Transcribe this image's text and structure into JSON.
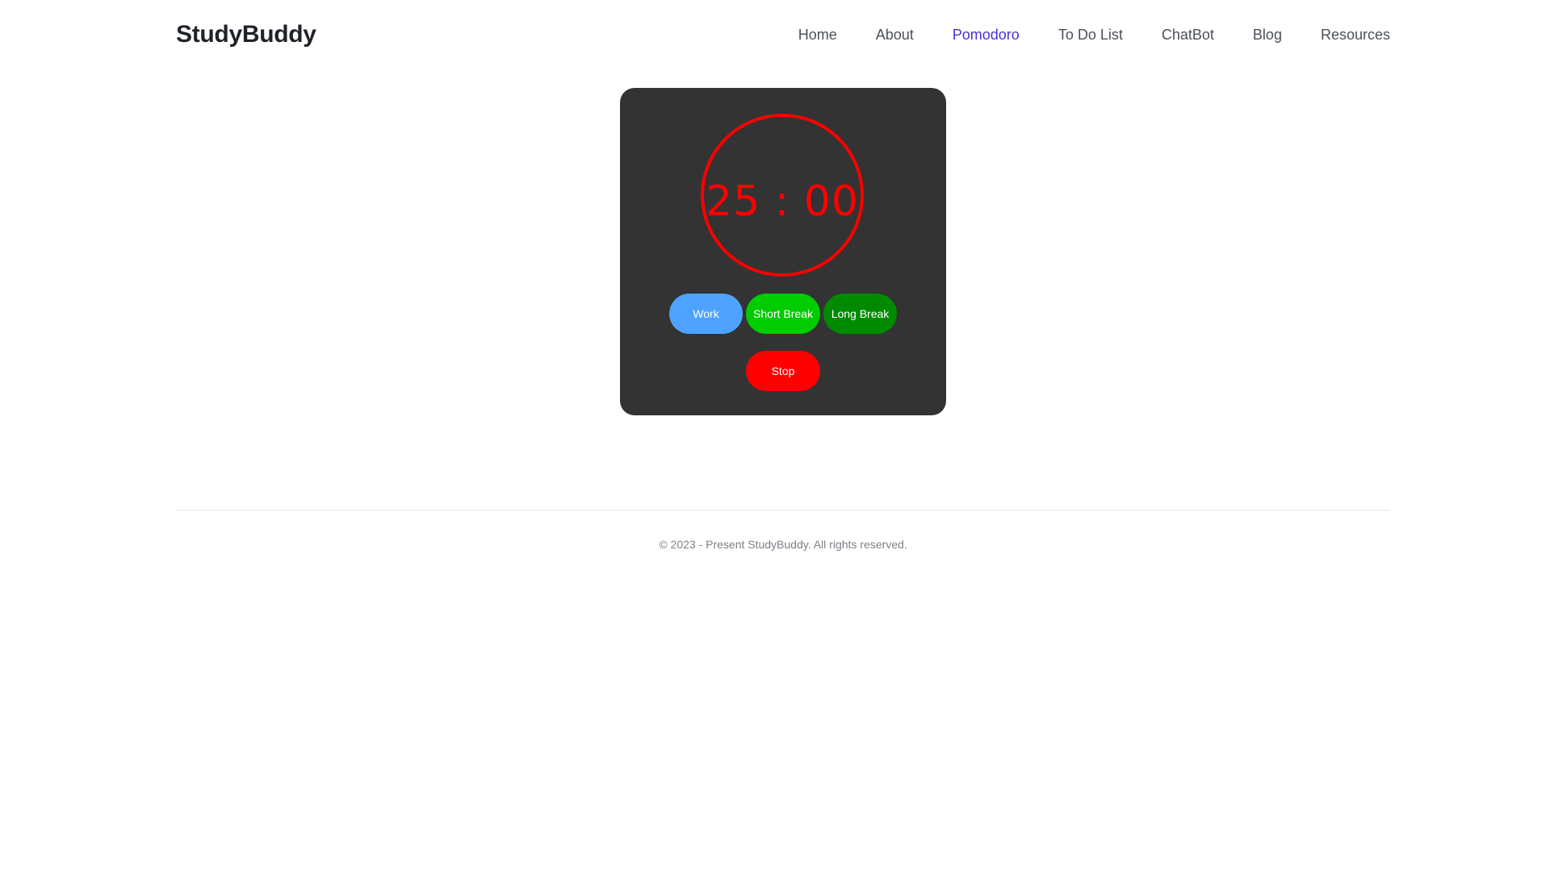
{
  "brand": "StudyBuddy",
  "nav": [
    {
      "label": "Home"
    },
    {
      "label": "About"
    },
    {
      "label": "Pomodoro",
      "active": true
    },
    {
      "label": "To Do List"
    },
    {
      "label": "ChatBot"
    },
    {
      "label": "Blog"
    },
    {
      "label": "Resources"
    }
  ],
  "timer": {
    "display": "25 : 00",
    "buttons": {
      "work": "Work",
      "short_break": "Short Break",
      "long_break": "Long Break",
      "stop": "Stop"
    }
  },
  "footer": {
    "text": "© 2023 - Present StudyBuddy. All rights reserved."
  },
  "colors": {
    "active_nav": "#4f2fd6",
    "timer_red": "#ff0000",
    "work": "#4da3ff",
    "short_break": "#00cc00",
    "long_break": "#008a00",
    "card": "#333333"
  }
}
